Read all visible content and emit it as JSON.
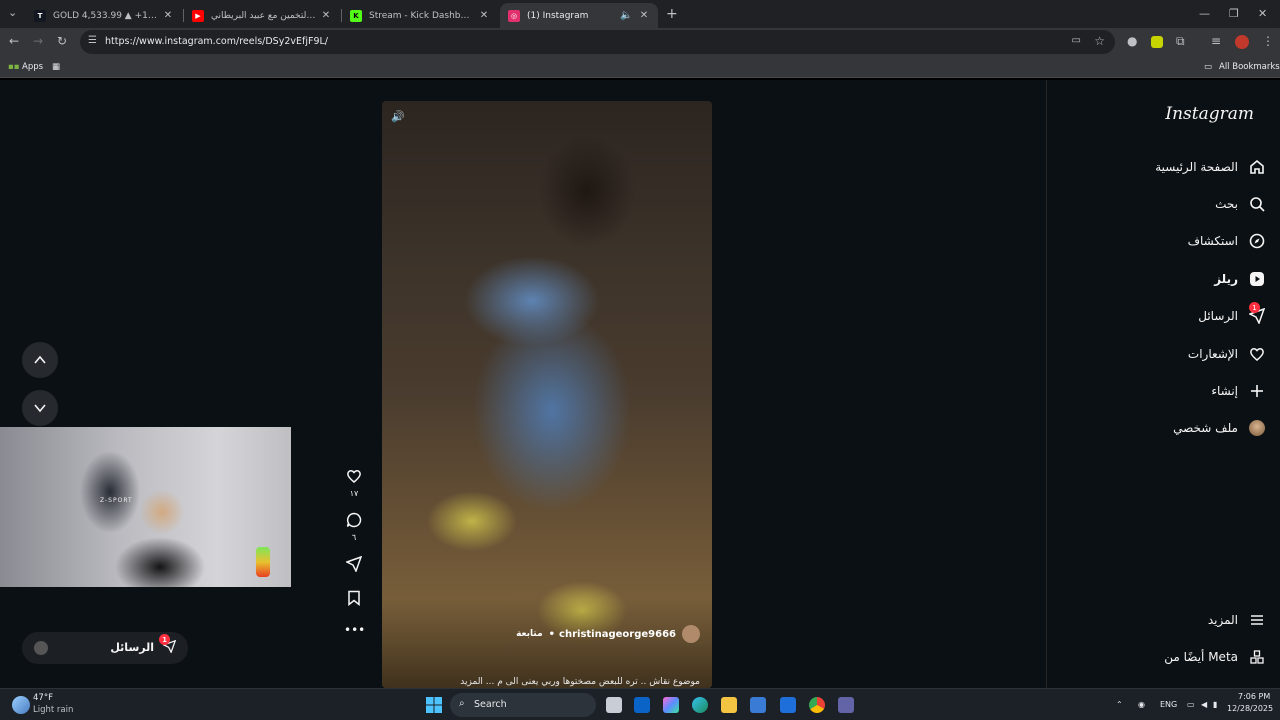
{
  "tabs": [
    {
      "title": "GOLD 4,533.99 ▲ +1.22% Unn",
      "color": "#ffffff",
      "glyph": "T"
    },
    {
      "title": "تحدي التخمين مع عبيد البريطاني",
      "color": "#ff0000",
      "glyph": "▶"
    },
    {
      "title": "Stream - Kick Dashboard",
      "color": "#53fc18",
      "glyph": "K"
    },
    {
      "title": "(1) Instagram",
      "color": "#e1306c",
      "glyph": "◎"
    }
  ],
  "address": {
    "url": "https://www.instagram.com/reels/DSy2vEfjF9L/"
  },
  "bookmarks": {
    "apps": "Apps",
    "all": "All Bookmarks"
  },
  "sidebar": {
    "logo": "Instagram",
    "items": [
      {
        "label": "الصفحة الرئيسية",
        "icon": "home-icon"
      },
      {
        "label": "بحث",
        "icon": "search-icon"
      },
      {
        "label": "استكشاف",
        "icon": "compass-icon"
      },
      {
        "label": "ريلز",
        "icon": "reels-icon"
      },
      {
        "label": "الرسائل",
        "icon": "messenger-icon",
        "badge": "1"
      },
      {
        "label": "الإشعارات",
        "icon": "heart-icon"
      },
      {
        "label": "إنشاء",
        "icon": "plus-icon"
      },
      {
        "label": "ملف شخصي",
        "icon": "avatar-icon"
      }
    ],
    "more": "المزيد",
    "meta": "أيضًا من Meta"
  },
  "reel": {
    "username": "christinageorge9666",
    "follow": "متابعة",
    "caption": "موضوع نقاش .. تره للبعض مصختوها وربي يعنى الى م ... المزيد",
    "likes": "١٧",
    "comments": "٦"
  },
  "webcam": {
    "chair_brand": "Z-SPORT"
  },
  "messages_bar": {
    "label": "الرسائل",
    "badge": "1"
  },
  "taskbar": {
    "weather_temp": "47°F",
    "weather_desc": "Light rain",
    "search": "Search",
    "lang": "ENG",
    "time": "7:06 PM",
    "date": "12/28/2025"
  }
}
